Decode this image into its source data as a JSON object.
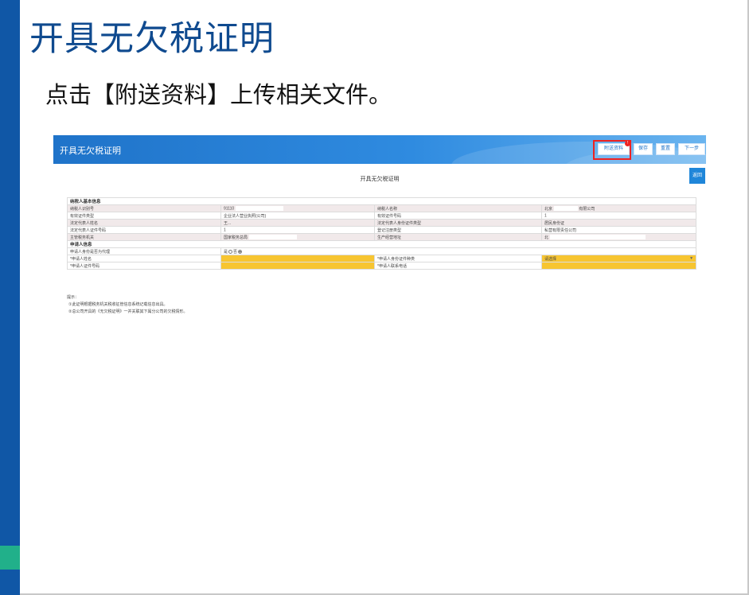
{
  "slide": {
    "title": "开具无欠税证明",
    "subtitle": "点击【附送资料】上传相关文件。"
  },
  "app": {
    "header_title": "开具无欠税证明",
    "buttons": {
      "attach": "附送资料",
      "save": "保存",
      "reset": "重置",
      "next": "下一步",
      "return": "返回"
    },
    "badge": "!",
    "form_title": "开具无欠税证明"
  },
  "form": {
    "section_taxpayer": "纳税人基本信息",
    "rows": [
      {
        "l1": "纳税人识别号",
        "v1": "91110",
        "l2": "纳税人名称",
        "v2": "北京",
        "v2b": "有限公司"
      },
      {
        "l1": "有效证件类型",
        "v1": "企业法人营业执照(公司)",
        "l2": "有效证件号码",
        "v2": "1"
      },
      {
        "l1": "法定代表人姓名",
        "v1": "王...",
        "l2": "法定代表人身份证件类型",
        "v2": "居民身份证"
      },
      {
        "l1": "法定代表人证件号码",
        "v1": "1",
        "l2": "登记注册类型",
        "v2": "私营有限责任公司"
      },
      {
        "l1": "主管税务机关",
        "v1": "国家税务总局",
        "l2": "生产经营地址",
        "v2": "北"
      }
    ],
    "section_applicant": "申请人信息",
    "agent_label": "申请人身份是否为代理",
    "agent_yes": "是",
    "agent_no": "否",
    "applicant_rows": [
      {
        "l1": "*申请人姓名",
        "l2": "*申请人身份证件种类",
        "v2": "请选择"
      },
      {
        "l1": "*申请人证件号码",
        "l2": "*申请人联系电话"
      }
    ]
  },
  "notes": {
    "title": "提示：",
    "items": [
      "①此证明根据税务机关税收征管信息系统记载信息出具。",
      "②总公司开具的《无欠税证明》一并关联其下属分公司的欠税情形。"
    ]
  },
  "colors": {
    "sidebar": "#1057a6",
    "accent": "#21b08a",
    "title_blue": "#0f4a8f",
    "highlight": "#e22",
    "required_field": "#f7c531"
  }
}
